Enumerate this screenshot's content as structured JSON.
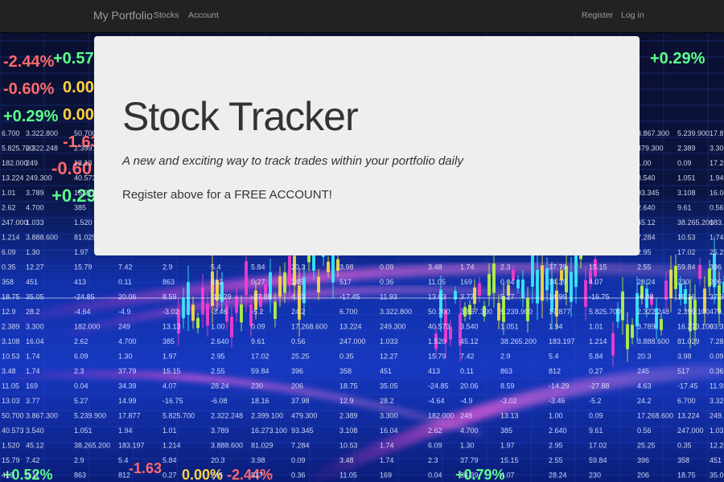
{
  "navbar": {
    "brand": "My Portfolio",
    "left_links": [
      "Stocks",
      "Account"
    ],
    "right_links": [
      "Register",
      "Log in"
    ],
    "background": "#222222",
    "link_color": "#9d9d9d"
  },
  "jumbotron": {
    "title": "Stock Tracker",
    "tagline": "A new and exciting way to track trades within your portfolio daily",
    "cta": "Register above for a FREE ACCOUNT!",
    "background": "#eeeeee"
  },
  "background": {
    "image": "stock-market-ticker-board",
    "tickers": [
      "-2.44%",
      "+0.57",
      "-0.60%",
      "0.00",
      "+0.29%",
      "0.00",
      "-1.63",
      "-0.60",
      "+0.29",
      "+0.29%",
      "+0.52%",
      "+0.79%",
      "-1.63",
      "0.00%",
      "-2.44%"
    ],
    "cells": [
      "6.700",
      "3.322.800",
      "50.700",
      "3.867.300",
      "5.239.900",
      "17.877",
      "5.825.700",
      "2.322.248",
      "2.399.100",
      "479.300",
      "2.389",
      "3.300",
      "182.000",
      "249",
      "13.13",
      "1.00",
      "0.09",
      "17.268.600",
      "13.224",
      "249.300",
      "40.573",
      "3.540",
      "1.051",
      "1.94",
      "1.01",
      "3.789",
      "16.273.100",
      "93.345",
      "3.108",
      "16.04",
      "2.62",
      "4.700",
      "385",
      "2.640",
      "9.61",
      "0.56",
      "247.000",
      "1.033",
      "1.520",
      "45.12",
      "38.265.200",
      "183.197",
      "1.214",
      "3.888.600",
      "81.029",
      "7.284",
      "10.53",
      "1.74",
      "6.09",
      "1.30",
      "1.97",
      "2.95",
      "17.02",
      "25.25",
      "0.35",
      "12.27",
      "15.79",
      "7.42",
      "2.9",
      "5.4",
      "5.84",
      "20.3",
      "3.98",
      "0.09",
      "3.48",
      "1.74",
      "2.3",
      "37.79",
      "15.15",
      "2.55",
      "59.84",
      "396",
      "358",
      "451",
      "413",
      "0.11",
      "863",
      "812",
      "0.27",
      "245",
      "517",
      "0.36",
      "11.05",
      "169",
      "0.04",
      "34.39",
      "4.07",
      "28.24",
      "230",
      "206",
      "18.75",
      "35.05",
      "-24.85",
      "20.06",
      "8.59",
      "-14.29",
      "-27.88",
      "4.63",
      "-17.45",
      "11.93",
      "13.03",
      "3.77",
      "5.27",
      "14.99",
      "-16.75",
      "-6.08",
      "18.16",
      "37.98",
      "12.9",
      "28.2",
      "-4.64",
      "-4.9",
      "-3.02",
      "-3.46",
      "-5.2",
      "24.2"
    ]
  }
}
